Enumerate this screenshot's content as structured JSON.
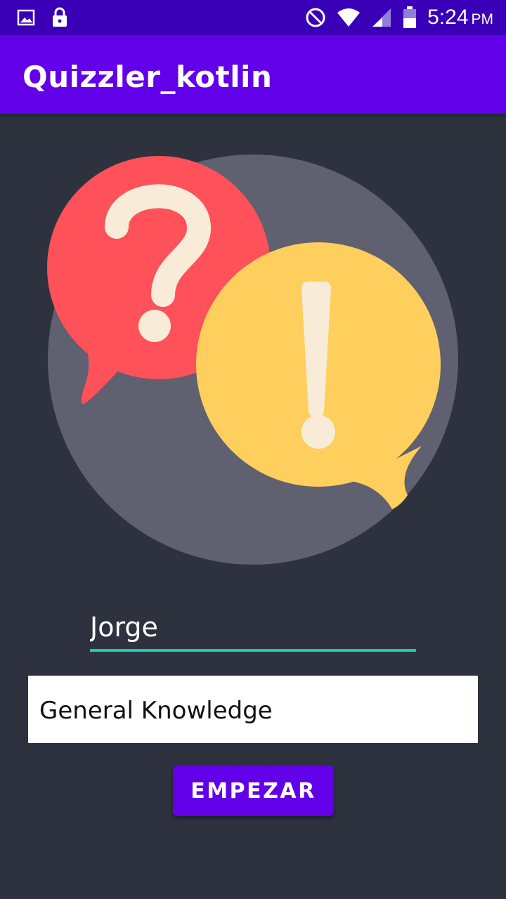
{
  "status_bar": {
    "time": "5:24",
    "ampm": "PM",
    "icons": [
      "gallery-icon",
      "lock-icon",
      "do-not-disturb-icon",
      "wifi-icon",
      "signal-icon",
      "battery-icon"
    ]
  },
  "app_bar": {
    "title": "Quizzler_kotlin"
  },
  "form": {
    "name_value": "Jorge",
    "category_selected": "General Knowledge",
    "start_label": "EMPEZAR"
  },
  "colors": {
    "status_bar": "#3a00b8",
    "app_bar": "#6200ea",
    "background": "#2e323f",
    "accent": "#16cfb8",
    "button": "#6200ea",
    "circle": "#5f6070",
    "question_bubble": "#ff5159",
    "exclaim_bubble": "#ffcf5d",
    "glyph": "#f8ebd8"
  },
  "hero_icons": [
    "question-bubble-icon",
    "exclamation-bubble-icon"
  ]
}
